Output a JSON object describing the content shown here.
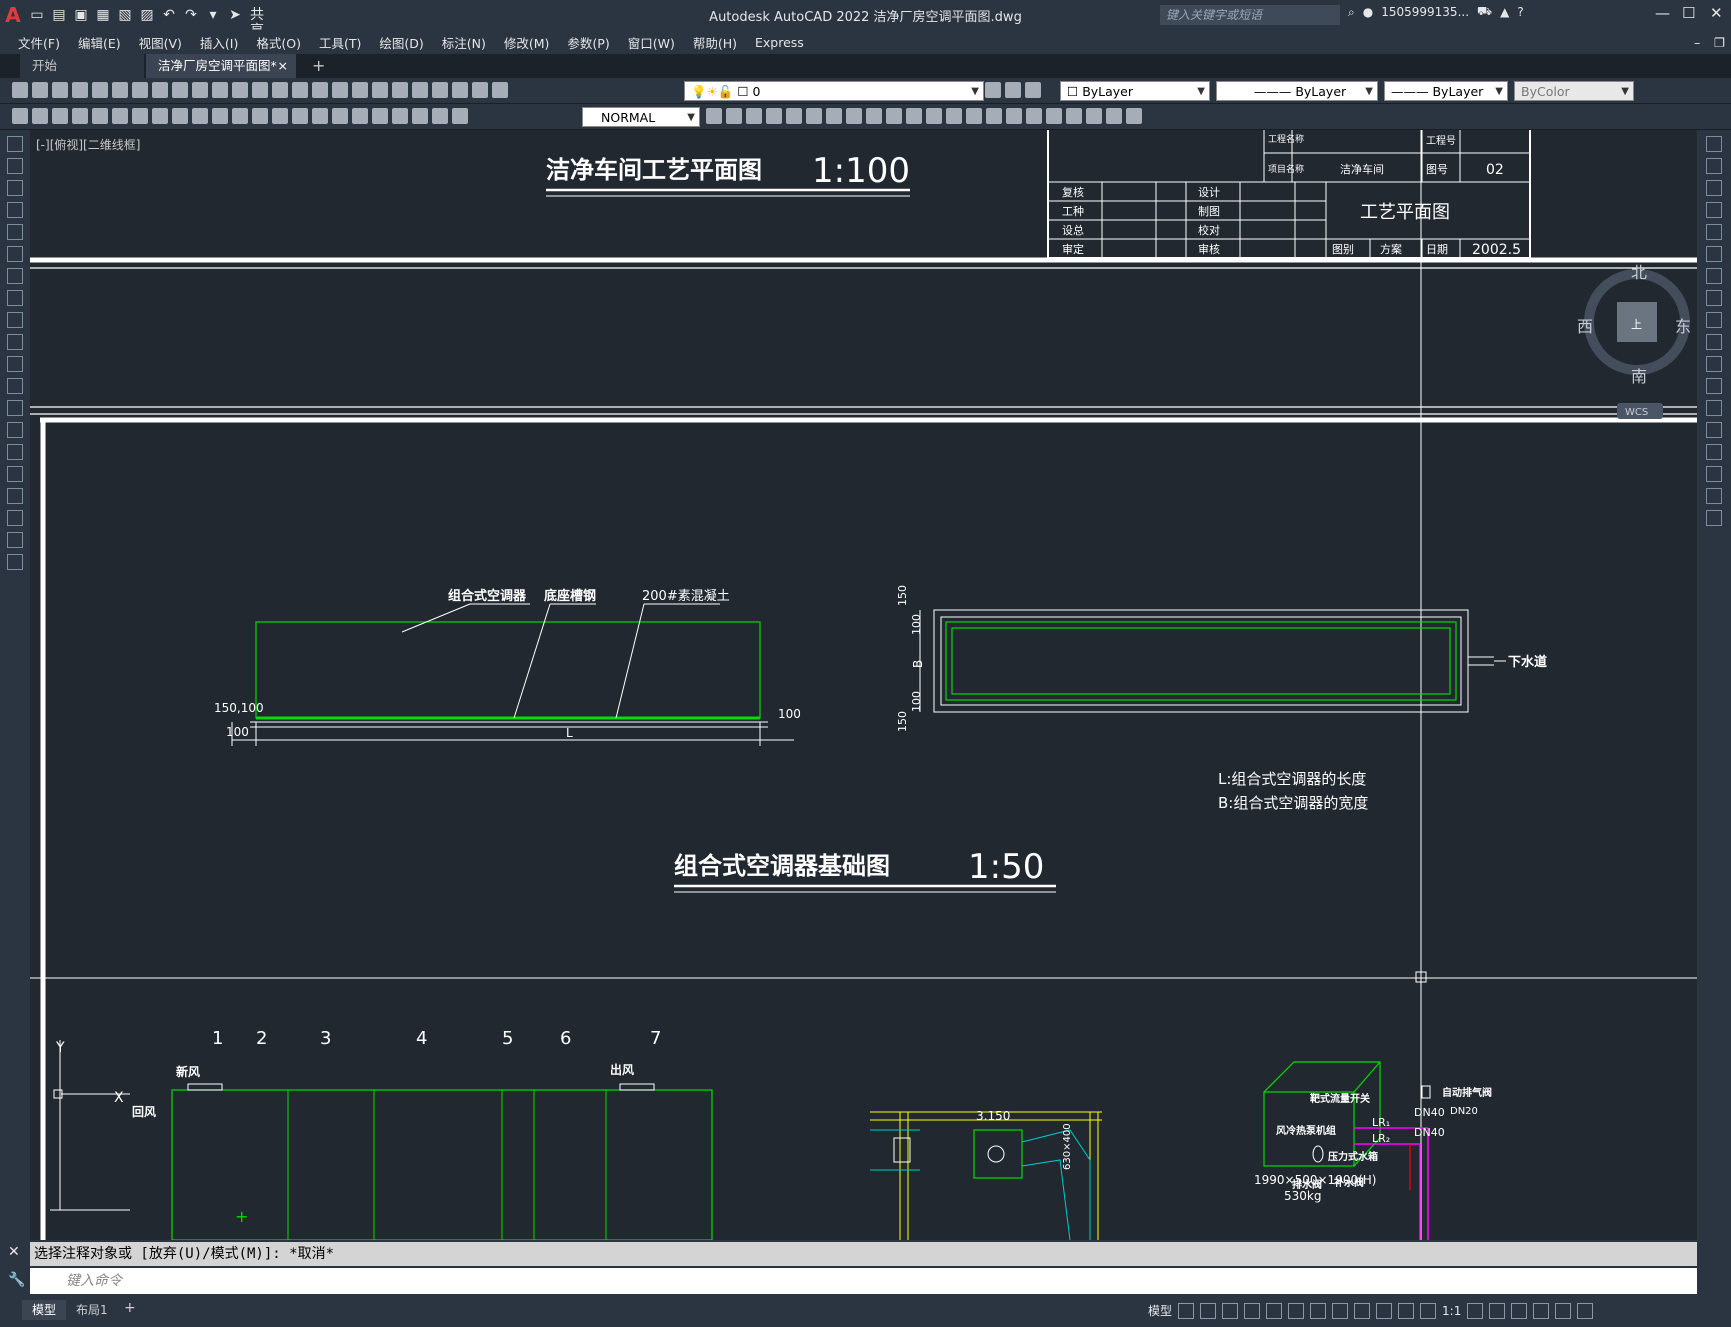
{
  "app": {
    "title": "Autodesk AutoCAD 2022    洁净厂房空调平面图.dwg",
    "share_label": "共享",
    "search_placeholder": "键入关键字或短语",
    "user": "1505999135...",
    "help": "?"
  },
  "menu": [
    "文件(F)",
    "编辑(E)",
    "视图(V)",
    "插入(I)",
    "格式(O)",
    "工具(T)",
    "绘图(D)",
    "标注(N)",
    "修改(M)",
    "参数(P)",
    "窗口(W)",
    "帮助(H)",
    "Express"
  ],
  "tabs": [
    {
      "label": "开始"
    },
    {
      "label": "洁净厂房空调平面图*",
      "close": "×"
    }
  ],
  "tab_add": "+",
  "layer_toolbar": {
    "layer_value": "0",
    "color": "ByLayer",
    "linetype": "ByLayer",
    "lineweight": "ByLayer",
    "plotstyle": "ByColor"
  },
  "dim_style": "NORMAL",
  "viewport_label": "[-][俯视][二维线框]",
  "viewcube": {
    "n": "北",
    "s": "南",
    "e": "东",
    "w": "西",
    "center": "上",
    "wcs": "WCS"
  },
  "drawing": {
    "title1": "洁净车间工艺平面图",
    "scale1": "1:100",
    "title2": "组合式空调器基础图",
    "scale2": "1:50",
    "titleblock": {
      "project_name_label": "工程名称",
      "item_name_label": "项目名称",
      "item_name": "洁净车间",
      "project_no_label": "工程号",
      "drawing_no_label": "图号",
      "drawing_no": "02",
      "rows": [
        {
          "a": "复核",
          "b": "设计"
        },
        {
          "a": "工种",
          "b": "制图"
        },
        {
          "a": "设总",
          "b": "校对"
        },
        {
          "a": "审定",
          "b": "审核"
        }
      ],
      "drawing_name": "工艺平面图",
      "stage_label": "图别",
      "stage": "方案",
      "date_label": "日期",
      "date": "2002.5"
    },
    "labels": {
      "ahu": "组合式空调器",
      "channel": "底座槽钢",
      "concrete": "200#素混凝土",
      "drain": "下水道",
      "note1": "L:组合式空调器的长度",
      "note2": "B:组合式空调器的宽度",
      "dim_150_100": "150,100",
      "dim_100": "100",
      "dim_L": "L",
      "dim_150": "150",
      "dim_B": "B",
      "chiller": "风冷热泵机组",
      "chiller_size": "1990×500×1900(H)",
      "chiller_weight": "530kg",
      "dn40a": "DN40",
      "dn40b": "DN40",
      "lr1": "LR₁",
      "lr2": "LR₂",
      "flow_switch": "靶式流量开关",
      "air_vent": "自动排气阀",
      "dn20": "DN20",
      "tank": "压力式水箱",
      "drain_valve": "排水阀",
      "fill_valve": "补水阀",
      "elev": "3.150",
      "duct": "630×400",
      "fresh_air": "新风",
      "return_air": "回风",
      "supply_air": "出风",
      "axis_y": "Y",
      "axis_x": "X",
      "sections": [
        "1",
        "2",
        "3",
        "4",
        "5",
        "6",
        "7"
      ]
    }
  },
  "command": {
    "history": "选择注释对象或 [放弃(U)/模式(M)]: *取消*",
    "placeholder": "键入命令"
  },
  "layouts": [
    "模型",
    "布局1"
  ],
  "layout_add": "+",
  "status": {
    "model": "模型",
    "scale": "1:1"
  }
}
